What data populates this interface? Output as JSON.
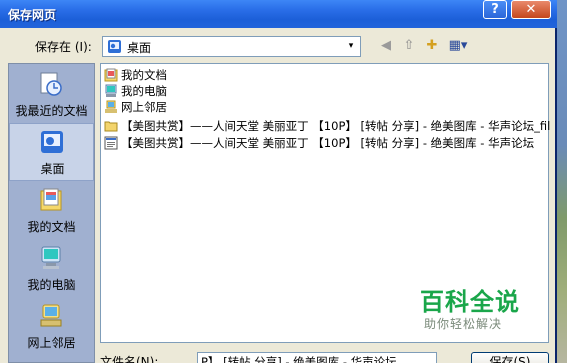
{
  "window": {
    "title": "保存网页",
    "help_label": "?",
    "close_label": "✕"
  },
  "toolbar": {
    "save_in_label": "保存在",
    "save_in_hotkey": "(I):",
    "location": "桌面",
    "dropdown_glyph": "▾",
    "back_glyph": "◀",
    "up_glyph": "⇧",
    "new_folder_glyph": "✚",
    "views_glyph": "▦▾"
  },
  "places": [
    {
      "label": "我最近的文档",
      "icon": "recent-documents-icon"
    },
    {
      "label": "桌面",
      "icon": "desktop-icon"
    },
    {
      "label": "我的文档",
      "icon": "my-documents-icon"
    },
    {
      "label": "我的电脑",
      "icon": "my-computer-icon"
    },
    {
      "label": "网上邻居",
      "icon": "network-places-icon"
    }
  ],
  "files": [
    {
      "name": "我的文档",
      "icon": "my-documents-icon"
    },
    {
      "name": "我的电脑",
      "icon": "my-computer-icon"
    },
    {
      "name": "网上邻居",
      "icon": "network-places-icon"
    },
    {
      "name": "【美图共赏】——人间天堂 美丽亚丁 【10P】 [转帖 分享] - 绝美图库 - 华声论坛_fil",
      "icon": "folder-icon"
    },
    {
      "name": "【美图共赏】——人间天堂 美丽亚丁 【10P】 [转帖 分享] - 绝美图库 - 华声论坛",
      "icon": "html-file-icon"
    }
  ],
  "footer": {
    "filename_label": "文件名(N):",
    "filename_value": "P】 [转帖 分享] - 绝美图库 - 华声论坛",
    "save_button": "保存(S)"
  },
  "watermark": {
    "title": "百科全说",
    "subtitle": "助你轻松解决"
  },
  "colors": {
    "titlebar": "#2a6ee8",
    "dialog_bg": "#ece9d8",
    "places_bg": "#a0b0d0",
    "watermark_green": "#1aa64a"
  }
}
